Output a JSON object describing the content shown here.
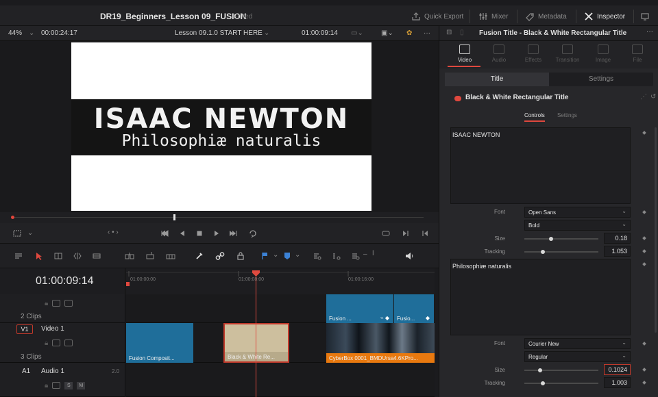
{
  "app": {
    "project_title": "DR19_Beginners_Lesson 09_FUSION",
    "status": "Edited"
  },
  "topbar": {
    "quick_export": "Quick Export",
    "mixer": "Mixer",
    "metadata": "Metadata",
    "inspector": "Inspector"
  },
  "viewer": {
    "zoom": "44%",
    "duration": "00:00:24:17",
    "timeline_name": "Lesson 09.1.0 START HERE",
    "timecode": "01:00:09:14",
    "title_line1": "ISAAC NEWTON",
    "title_line2": "Philosophiæ naturalis"
  },
  "timeline": {
    "timecode": "01:00:09:14",
    "ruler": [
      "01:00:00:00",
      "01:00:08:00",
      "01:00:16:00"
    ],
    "tracks": [
      {
        "id": "v2",
        "clips_label": "2 Clips"
      },
      {
        "id": "V1",
        "name": "Video 1",
        "clips_label": "3 Clips"
      },
      {
        "id": "A1",
        "name": "Audio 1",
        "level": "2.0"
      }
    ],
    "clips": {
      "v2_fusion_a": "Fusion ...",
      "v2_fusion_b": "Fusio...",
      "v1_fusion_comp": "Fusion Composit...",
      "v1_black_white": "Black & White Re...",
      "v1_cyberbox": "CyberBox 0001_BMDUrsa4.6KPro..."
    },
    "audio_buttons": [
      "S",
      "M"
    ]
  },
  "inspector": {
    "header_title": "Fusion Title - Black & White Rectangular Title",
    "tabs": [
      "Video",
      "Audio",
      "Effects",
      "Transition",
      "Image",
      "File"
    ],
    "active_tab": "Video",
    "subtabs": [
      "Title",
      "Settings"
    ],
    "effect_name": "Black & White Rectangular Title",
    "control_tabs": [
      "Controls",
      "Settings"
    ],
    "text1": {
      "value": "ISAAC NEWTON",
      "font_label": "Font",
      "font": "Open Sans",
      "style": "Bold",
      "size_label": "Size",
      "size": "0.18",
      "tracking_label": "Tracking",
      "tracking": "1.053"
    },
    "text2": {
      "value": "Philosophiæ naturalis",
      "font_label": "Font",
      "font": "Courier New",
      "style": "Regular",
      "size_label": "Size",
      "size": "0.1024",
      "tracking_label": "Tracking",
      "tracking": "1.003"
    }
  },
  "colors": {
    "accent_red": "#e0483e",
    "clip_blue": "#1f6e9a",
    "clip_beige": "#cdbf9e",
    "clip_orange": "#e8790f"
  }
}
